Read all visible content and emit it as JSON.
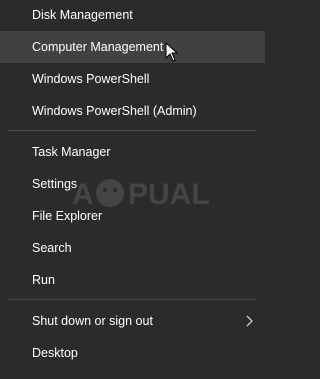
{
  "menu": {
    "items": [
      {
        "label": "Disk Management"
      },
      {
        "label": "Computer Management"
      },
      {
        "label": "Windows PowerShell"
      },
      {
        "label": "Windows PowerShell (Admin)"
      },
      {
        "label": "Task Manager"
      },
      {
        "label": "Settings"
      },
      {
        "label": "File Explorer"
      },
      {
        "label": "Search"
      },
      {
        "label": "Run"
      },
      {
        "label": "Shut down or sign out"
      },
      {
        "label": "Desktop"
      }
    ]
  },
  "icons": {
    "submenu": "chevron-right-icon",
    "pointer": "mouse-pointer-icon"
  },
  "colors": {
    "background": "#2b2b2b",
    "hover": "#414141",
    "divider": "#4a4a4a",
    "text": "#ffffff"
  },
  "watermark": {
    "text": "APPUALS"
  }
}
